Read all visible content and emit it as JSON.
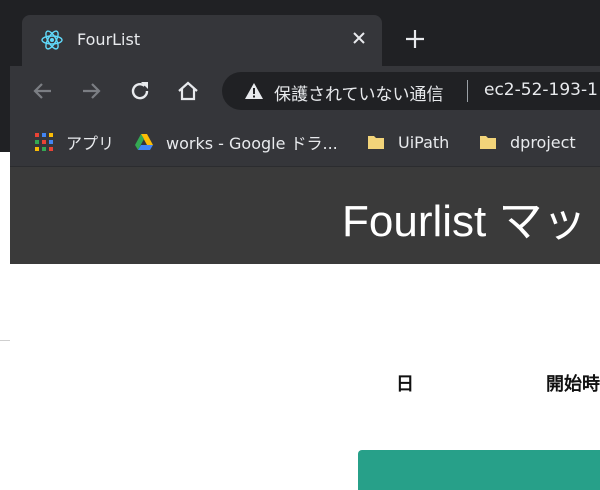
{
  "browser": {
    "tab": {
      "title": "FourList",
      "icon": "react-atom-icon"
    },
    "new_tab_icon": "plus-icon",
    "nav": {
      "back_icon": "back-arrow-icon",
      "forward_icon": "forward-arrow-icon",
      "reload_icon": "reload-icon",
      "home_icon": "home-icon"
    },
    "omnibox": {
      "security_text": "保護されていない通信",
      "url": "ec2-52-193-1"
    },
    "bookmarks": [
      {
        "label": "アプリ",
        "icon": "apps-grid-icon"
      },
      {
        "label": "works - Google ドラ...",
        "icon": "google-drive-icon"
      },
      {
        "label": "UiPath",
        "icon": "folder-icon"
      },
      {
        "label": "dproject",
        "icon": "folder-icon"
      }
    ]
  },
  "page": {
    "header_title": "Fourlist マッ",
    "columns": {
      "day": "日",
      "start": "開始時"
    },
    "accent_color": "#27a089"
  },
  "colors": {
    "tabstrip": "#202124",
    "toolbar": "#35363a",
    "header": "#3a3a3a"
  }
}
